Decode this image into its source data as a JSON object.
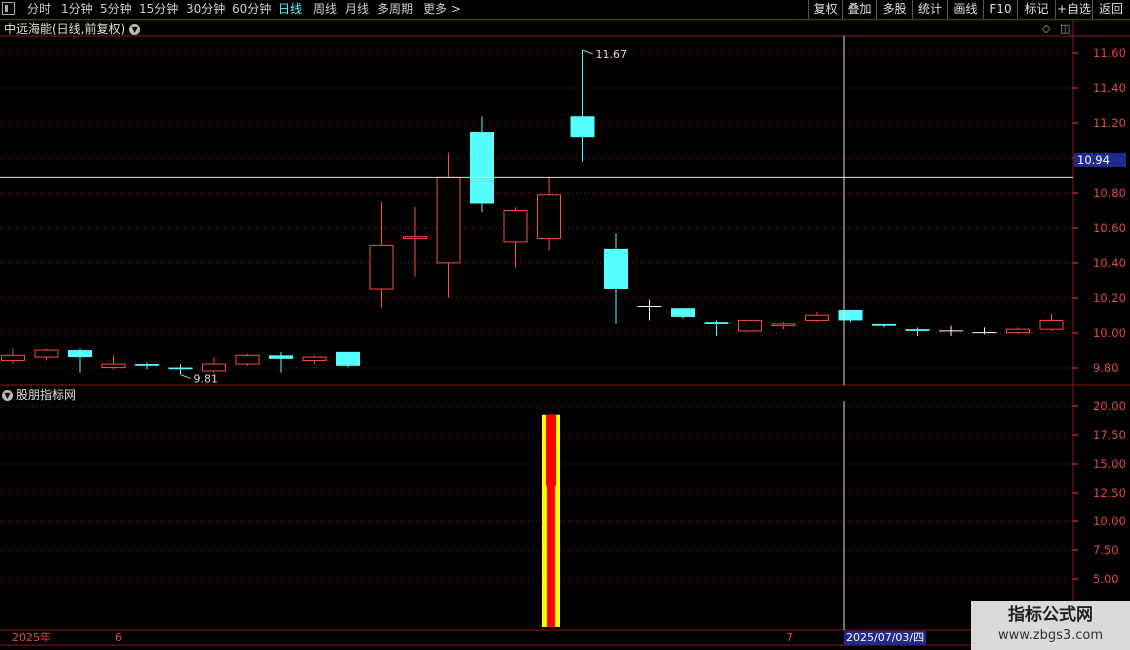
{
  "toolbar": {
    "periods": [
      {
        "label": "分时"
      },
      {
        "label": "1分钟"
      },
      {
        "label": "5分钟"
      },
      {
        "label": "15分钟"
      },
      {
        "label": "30分钟"
      },
      {
        "label": "60分钟"
      },
      {
        "label": "日线",
        "active": true
      },
      {
        "label": "周线"
      },
      {
        "label": "月线"
      },
      {
        "label": "多周期"
      },
      {
        "label": "更多"
      }
    ],
    "right_buttons": [
      {
        "label": "复权"
      },
      {
        "label": "叠加"
      },
      {
        "label": "多股"
      },
      {
        "label": "统计"
      },
      {
        "label": "画线"
      },
      {
        "label": "F10"
      },
      {
        "label": "标记"
      },
      {
        "label": "+自选"
      },
      {
        "label": "返回"
      }
    ]
  },
  "main_panel": {
    "title": "中远海能(日线,前复权)"
  },
  "sub_panel": {
    "title": "股朋指标网"
  },
  "price_axis": [
    "11.60",
    "11.40",
    "11.20",
    "11.00",
    "10.80",
    "10.60",
    "10.40",
    "10.20",
    "10.00",
    "9.80"
  ],
  "indicator_axis": [
    "20.00",
    "17.50",
    "15.00",
    "12.50",
    "10.00",
    "7.50",
    "5.00"
  ],
  "crosshair": {
    "price": "10.94",
    "date": "2025/07/03/四"
  },
  "annotations": {
    "high": "11.67",
    "low": "9.81"
  },
  "date_axis": [
    {
      "label": "2025年"
    },
    {
      "label": "6"
    },
    {
      "label": "7"
    }
  ],
  "watermark": {
    "line1": "指标公式网",
    "line2": "www.zbgs3.com"
  },
  "colors": {
    "up": "#ff4a4a",
    "down": "#55ffff",
    "doji": "#ffffff",
    "grid": "#8a1d1d",
    "axis": "#e24a4a",
    "crosshair_tag": "#1e2a8c",
    "indicator_outer": "#ffff00",
    "indicator_inner": "#ff0000"
  },
  "chart_data": {
    "type": "candlestick",
    "candles": [
      {
        "o": 9.89,
        "c": 9.92,
        "h": 9.96,
        "l": 9.87
      },
      {
        "o": 9.91,
        "c": 9.95,
        "h": 9.96,
        "l": 9.89
      },
      {
        "o": 9.95,
        "c": 9.91,
        "h": 9.96,
        "l": 9.82
      },
      {
        "o": 9.85,
        "c": 9.87,
        "h": 9.92,
        "l": 9.84
      },
      {
        "o": 9.87,
        "c": 9.86,
        "h": 9.88,
        "l": 9.84
      },
      {
        "o": 9.85,
        "c": 9.84,
        "h": 9.87,
        "l": 9.81
      },
      {
        "o": 9.83,
        "c": 9.87,
        "h": 9.91,
        "l": 9.82
      },
      {
        "o": 9.87,
        "c": 9.92,
        "h": 9.93,
        "l": 9.86
      },
      {
        "o": 9.92,
        "c": 9.9,
        "h": 9.94,
        "l": 9.82
      },
      {
        "o": 9.89,
        "c": 9.91,
        "h": 9.92,
        "l": 9.87
      },
      {
        "o": 9.94,
        "c": 9.86,
        "h": 9.94,
        "l": 9.85
      },
      {
        "o": 10.3,
        "c": 10.55,
        "h": 10.8,
        "l": 10.19
      },
      {
        "o": 10.59,
        "c": 10.6,
        "h": 10.77,
        "l": 10.37
      },
      {
        "o": 10.45,
        "c": 10.94,
        "h": 11.08,
        "l": 10.25
      },
      {
        "o": 11.2,
        "c": 10.79,
        "h": 11.29,
        "l": 10.74
      },
      {
        "o": 10.57,
        "c": 10.75,
        "h": 10.77,
        "l": 10.42
      },
      {
        "o": 10.59,
        "c": 10.84,
        "h": 10.94,
        "l": 10.52
      },
      {
        "o": 11.29,
        "c": 11.17,
        "h": 11.67,
        "l": 11.03
      },
      {
        "o": 10.53,
        "c": 10.3,
        "h": 10.62,
        "l": 10.1
      },
      {
        "o": 10.2,
        "c": 10.2,
        "h": 10.24,
        "l": 10.12
      },
      {
        "o": 10.19,
        "c": 10.14,
        "h": 10.19,
        "l": 10.13
      },
      {
        "o": 10.11,
        "c": 10.1,
        "h": 10.12,
        "l": 10.03
      },
      {
        "o": 10.06,
        "c": 10.12,
        "h": 10.12,
        "l": 10.06
      },
      {
        "o": 10.09,
        "c": 10.1,
        "h": 10.11,
        "l": 10.07
      },
      {
        "o": 10.12,
        "c": 10.15,
        "h": 10.17,
        "l": 10.11
      },
      {
        "o": 10.18,
        "c": 10.12,
        "h": 10.18,
        "l": 10.11
      },
      {
        "o": 10.1,
        "c": 10.09,
        "h": 10.1,
        "l": 10.08
      },
      {
        "o": 10.07,
        "c": 10.06,
        "h": 10.08,
        "l": 10.03
      },
      {
        "o": 10.06,
        "c": 10.06,
        "h": 10.09,
        "l": 10.03
      },
      {
        "o": 10.05,
        "c": 10.05,
        "h": 10.08,
        "l": 10.04
      },
      {
        "o": 10.05,
        "c": 10.07,
        "h": 10.08,
        "l": 10.04
      },
      {
        "o": 10.07,
        "c": 10.12,
        "h": 10.16,
        "l": 10.06
      }
    ],
    "price_range": [
      9.75,
      11.75
    ],
    "indicator": {
      "range": [
        0,
        21.2
      ],
      "bars": [
        {
          "index": 16,
          "outer": 20.0,
          "inner_top": 20.0,
          "inner_bottom": 7.4
        }
      ]
    }
  }
}
